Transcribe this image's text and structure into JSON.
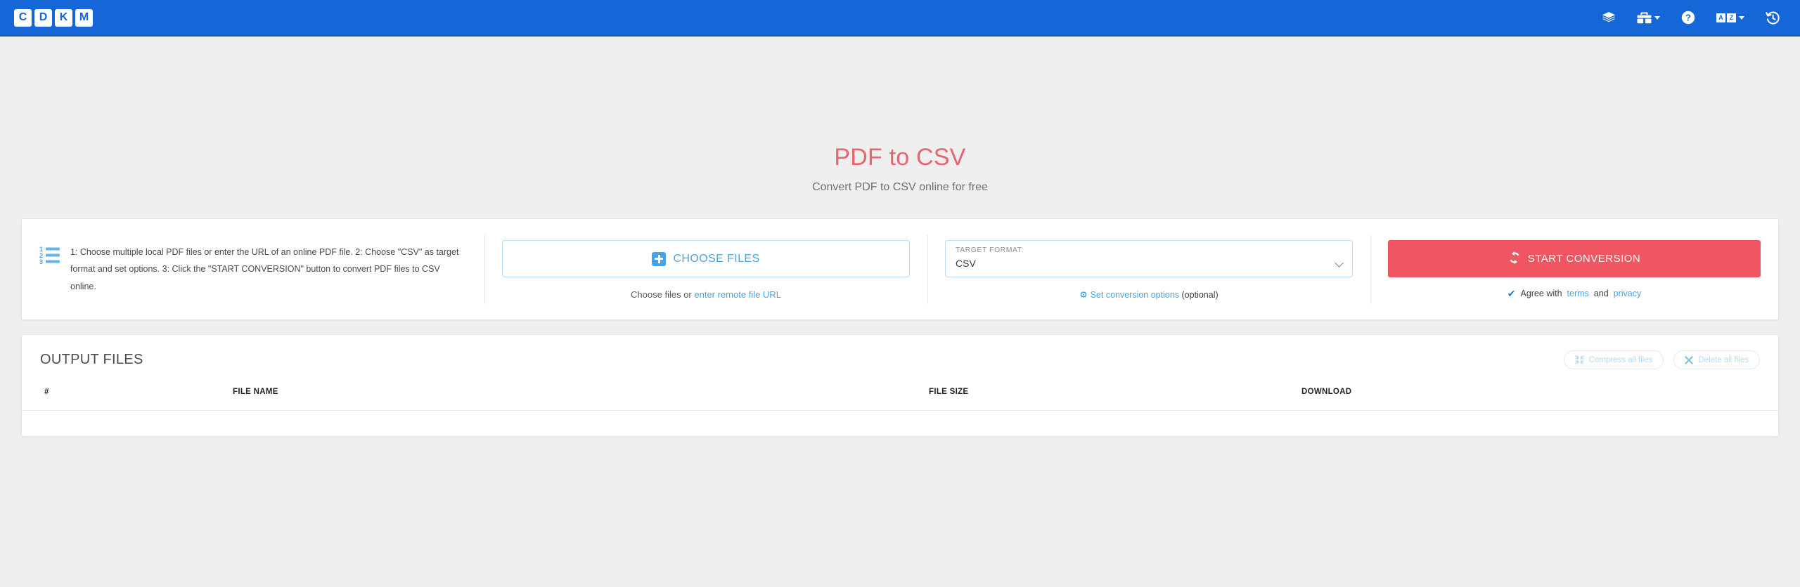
{
  "navbar": {
    "logo_letters": [
      "C",
      "D",
      "K",
      "M"
    ],
    "items": [
      {
        "name": "layers",
        "icon": "layers-icon",
        "label": "",
        "has_caret": false
      },
      {
        "name": "tools",
        "icon": "toolbox-icon",
        "label": "",
        "has_caret": true
      },
      {
        "name": "help",
        "icon": "question-circle-icon",
        "label": "",
        "has_caret": false
      },
      {
        "name": "language",
        "icon": "language-icon",
        "label": "",
        "has_caret": true,
        "boxes": [
          "A",
          "Z"
        ]
      },
      {
        "name": "history",
        "icon": "history-icon",
        "label": "",
        "has_caret": false
      }
    ]
  },
  "hero": {
    "title": "PDF to CSV",
    "subtitle": "Convert PDF to CSV online for free"
  },
  "converter": {
    "instructions": "1: Choose multiple local PDF files or enter the URL of an online PDF file. 2: Choose \"CSV\" as target format and set options. 3: Click the \"START CONVERSION\" button to convert PDF files to CSV online.",
    "choose_files_label": "CHOOSE FILES",
    "choose_hint_prefix": "Choose files or ",
    "choose_hint_link": "enter remote file URL",
    "target_format_label": "TARGET FORMAT:",
    "target_format_value": "CSV",
    "conversion_options_link": "Set conversion options",
    "conversion_options_suffix": " (optional)",
    "start_button_label": "START CONVERSION",
    "agree_prefix": "Agree with ",
    "agree_terms": "terms",
    "agree_middle": " and ",
    "agree_privacy": "privacy"
  },
  "output": {
    "title": "OUTPUT FILES",
    "compress_all_label": "Compress all files",
    "delete_all_label": "Delete all files",
    "columns": [
      "#",
      "FILE NAME",
      "FILE SIZE",
      "DOWNLOAD"
    ],
    "rows": []
  },
  "colors": {
    "navbar": "#1566d6",
    "accent_red": "#f05662",
    "link_blue": "#4da3e0",
    "page_bg": "#efefef"
  }
}
